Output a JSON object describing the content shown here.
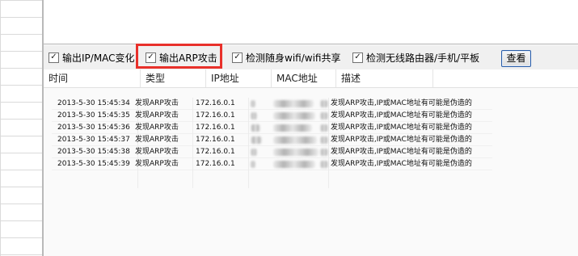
{
  "toolbar": {
    "checkboxes": [
      {
        "label": "输出IP/MAC变化",
        "checked": true
      },
      {
        "label": "输出ARP攻击",
        "checked": true
      },
      {
        "label": "检测随身wifi/wifi共享",
        "checked": true
      },
      {
        "label": "检测无线路由器/手机/平板",
        "checked": true
      }
    ],
    "view_button": "查看"
  },
  "columns": [
    "时间",
    "类型",
    "IP地址",
    "MAC地址",
    "描述"
  ],
  "rows": [
    {
      "time": "2013-5-30 15:45:34",
      "type": "发现ARP攻击",
      "ip": "172.16.0.1",
      "desc": "发现ARP攻击,IP或MAC地址有可能是伪造的"
    },
    {
      "time": "2013-5-30 15:45:35",
      "type": "发现ARP攻击",
      "ip": "172.16.0.1",
      "desc": "发现ARP攻击,IP或MAC地址有可能是伪造的"
    },
    {
      "time": "2013-5-30 15:45:36",
      "type": "发现ARP攻击",
      "ip": "172.16.0.1",
      "desc": "发现ARP攻击,IP或MAC地址有可能是伪造的"
    },
    {
      "time": "2013-5-30 15:45:37",
      "type": "发现ARP攻击",
      "ip": "172.16.0.1",
      "desc": "发现ARP攻击,IP或MAC地址有可能是伪造的"
    },
    {
      "time": "2013-5-30 15:45:38",
      "type": "发现ARP攻击",
      "ip": "172.16.0.1",
      "desc": "发现ARP攻击,IP或MAC地址有可能是伪造的"
    },
    {
      "time": "2013-5-30 15:45:39",
      "type": "发现ARP攻击",
      "ip": "172.16.0.1",
      "desc": "发现ARP攻击,IP或MAC地址有可能是伪造的"
    }
  ],
  "colors": {
    "highlight": "#e8302a",
    "button_border": "#2a5da8"
  },
  "icons": {
    "checkbox_checked": "check-icon"
  }
}
